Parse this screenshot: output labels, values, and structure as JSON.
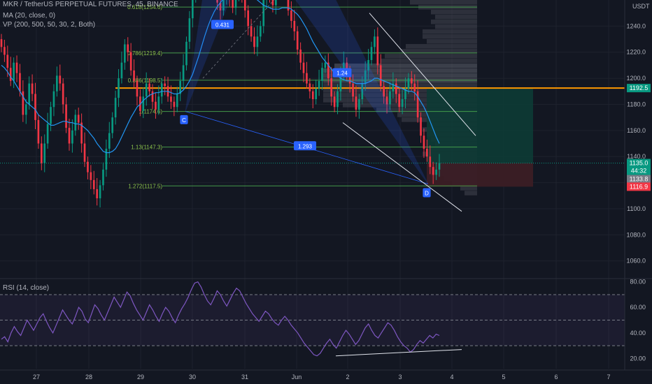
{
  "header": {
    "symbol_line": "MKR / TetherUS PERPETUAL FUTURES, 45, BINANCE",
    "ma_line": "MA (20, close, 0)",
    "vp_line": "VP (200, 500, 50, 30, 2, Both)",
    "currency": "USDT"
  },
  "rsi_header": "RSI (14, close)",
  "chart_data": {
    "type": "candlestick",
    "price_axis": {
      "ticks": [
        1060,
        1080,
        1100,
        1120,
        1140,
        1160,
        1180,
        1200,
        1220,
        1240
      ],
      "tick_labels": [
        "1060.0",
        "1080.0",
        "1100.0",
        "1120.0",
        "1140.0",
        "1160.0",
        "1180.0",
        "1200.0",
        "1220.0",
        "1240.0"
      ],
      "range": [
        1047,
        1260
      ]
    },
    "rsi_axis": {
      "ticks": [
        20,
        40,
        60,
        80
      ],
      "tick_labels": [
        "20.00",
        "40.00",
        "60.00",
        "80.00"
      ],
      "range": [
        12,
        82
      ],
      "band": [
        30,
        70
      ],
      "mid": 50
    },
    "time_axis": {
      "labels": [
        "27",
        "28",
        "29",
        "30",
        "31",
        "Jun",
        "2",
        "3",
        "4",
        "5",
        "6",
        "7"
      ]
    },
    "price_labels": [
      {
        "value": 1192.5,
        "text": "1192.5",
        "color": "#089981"
      },
      {
        "value": 1135.0,
        "text": "1135.0",
        "color": "#089981"
      },
      {
        "value": 1135.0,
        "text": "44:32",
        "color": "#089981",
        "sub": true
      },
      {
        "value": 1133.8,
        "text": "1133.8",
        "color": "#787b86"
      },
      {
        "value": 1116.9,
        "text": "1116.9",
        "color": "#f23645"
      }
    ],
    "fib_levels": [
      {
        "value": 1254.6,
        "label": "0.618(1254.6)"
      },
      {
        "value": 1219.4,
        "label": "0.786(1219.4)"
      },
      {
        "value": 1198.5,
        "label": "0.886(1198.5)"
      },
      {
        "value": 1174.6,
        "label": "1(1174.6)"
      },
      {
        "value": 1147.3,
        "label": "1.13(1147.3)"
      },
      {
        "value": 1117.5,
        "label": "1.272(1117.5)"
      }
    ],
    "horizontal_line": 1192.5,
    "harmonic_labels": [
      {
        "text": "0.431"
      },
      {
        "text": "1.24"
      },
      {
        "text": "1.293"
      },
      {
        "text": "C"
      },
      {
        "text": "D"
      }
    ],
    "close_series": [
      1224,
      1218,
      1208,
      1198,
      1212,
      1204,
      1190,
      1172,
      1180,
      1196,
      1188,
      1168,
      1150,
      1135,
      1150,
      1165,
      1178,
      1190,
      1202,
      1196,
      1180,
      1162,
      1150,
      1160,
      1172,
      1166,
      1150,
      1136,
      1128,
      1122,
      1115,
      1108,
      1118,
      1130,
      1146,
      1158,
      1170,
      1185,
      1200,
      1212,
      1226,
      1220,
      1206,
      1198,
      1186,
      1175,
      1186,
      1196,
      1190,
      1182,
      1176,
      1186,
      1196,
      1194,
      1186,
      1182,
      1178,
      1188,
      1198,
      1210,
      1228,
      1246,
      1262,
      1284,
      1292,
      1292,
      1292,
      1292,
      1286,
      1270,
      1258,
      1252,
      1262,
      1270,
      1262,
      1254,
      1266,
      1278,
      1262,
      1252,
      1240,
      1232,
      1224,
      1232,
      1240,
      1260,
      1274,
      1262,
      1256,
      1266,
      1272,
      1275,
      1268,
      1252,
      1244,
      1236,
      1222,
      1212,
      1204,
      1196,
      1190,
      1184,
      1192,
      1198,
      1208,
      1212,
      1200,
      1186,
      1178,
      1190,
      1202,
      1212,
      1204,
      1196,
      1186,
      1176,
      1184,
      1196,
      1206,
      1214,
      1224,
      1232,
      1210,
      1194,
      1186,
      1180,
      1190,
      1196,
      1188,
      1178,
      1184,
      1192,
      1200,
      1196,
      1190,
      1170,
      1156,
      1146,
      1140,
      1132,
      1126,
      1130,
      1135
    ],
    "ma20_series": [
      1210,
      1208,
      1205,
      1201,
      1198,
      1194,
      1190,
      1186,
      1182,
      1180,
      1178,
      1176,
      1172,
      1170,
      1168,
      1166,
      1164,
      1164,
      1165,
      1166,
      1167,
      1167,
      1166,
      1166,
      1165,
      1165,
      1164,
      1162,
      1160,
      1157,
      1154,
      1150,
      1147,
      1144,
      1143,
      1143,
      1144,
      1146,
      1150,
      1155,
      1160,
      1165,
      1170,
      1174,
      1178,
      1180,
      1183,
      1185,
      1187,
      1188,
      1189,
      1189,
      1190,
      1190,
      1190,
      1189,
      1188,
      1188,
      1189,
      1191,
      1194,
      1198,
      1203,
      1210,
      1217,
      1225,
      1233,
      1240,
      1246,
      1251,
      1255,
      1258,
      1261,
      1263,
      1265,
      1266,
      1267,
      1268,
      1268,
      1267,
      1266,
      1264,
      1262,
      1260,
      1258,
      1256,
      1255,
      1254,
      1253,
      1253,
      1253,
      1254,
      1254,
      1254,
      1253,
      1251,
      1249,
      1246,
      1242,
      1238,
      1233,
      1228,
      1224,
      1220,
      1216,
      1213,
      1210,
      1207,
      1204,
      1202,
      1200,
      1199,
      1198,
      1198,
      1197,
      1196,
      1196,
      1196,
      1196,
      1197,
      1198,
      1200,
      1200,
      1199,
      1198,
      1197,
      1196,
      1195,
      1194,
      1193,
      1192,
      1191,
      1190,
      1190,
      1189,
      1186,
      1182,
      1178,
      1173,
      1167,
      1161,
      1155,
      1150
    ],
    "rsi_series": [
      35,
      37,
      33,
      40,
      45,
      41,
      38,
      44,
      50,
      46,
      42,
      47,
      52,
      55,
      49,
      44,
      40,
      46,
      52,
      58,
      54,
      50,
      47,
      53,
      60,
      57,
      51,
      48,
      55,
      62,
      59,
      54,
      50,
      56,
      62,
      68,
      64,
      60,
      66,
      72,
      69,
      63,
      58,
      54,
      50,
      56,
      62,
      58,
      53,
      49,
      55,
      60,
      57,
      52,
      48,
      54,
      59,
      63,
      68,
      74,
      79,
      80,
      76,
      70,
      65,
      62,
      67,
      73,
      70,
      65,
      61,
      66,
      71,
      75,
      73,
      68,
      63,
      59,
      55,
      52,
      49,
      53,
      57,
      55,
      51,
      48,
      46,
      50,
      53,
      50,
      46,
      43,
      40,
      36,
      32,
      29,
      26,
      23,
      22,
      24,
      28,
      32,
      35,
      31,
      28,
      33,
      38,
      42,
      39,
      35,
      31,
      34,
      39,
      44,
      47,
      42,
      38,
      36,
      40,
      44,
      48,
      46,
      42,
      37,
      33,
      30,
      28,
      25,
      27,
      31,
      34,
      32,
      35,
      38,
      36,
      39,
      38
    ]
  }
}
